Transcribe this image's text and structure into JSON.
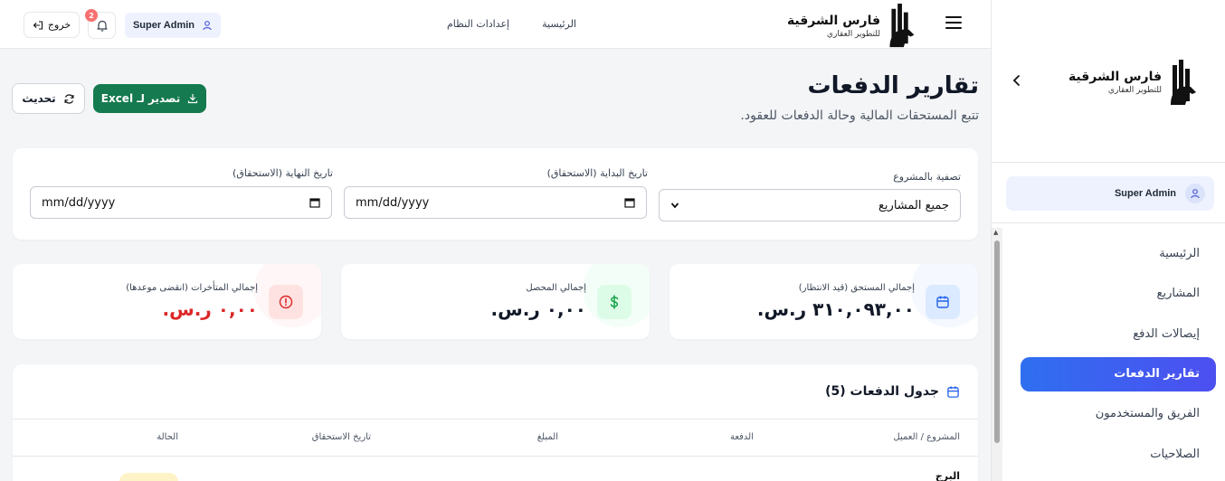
{
  "brand": {
    "name": "فارس الشرقية",
    "tagline": "للتطوير العقاري"
  },
  "topbar": {
    "nav": [
      {
        "label": "الرئيسية"
      },
      {
        "label": "إعدادات النظام"
      }
    ],
    "user_name": "Super Admin",
    "notifications_count": "2",
    "logout_label": "خروج"
  },
  "sidebar": {
    "user_name": "Super Admin",
    "items": [
      {
        "label": "الرئيسية"
      },
      {
        "label": "المشاريع"
      },
      {
        "label": "إيصالات الدفع"
      },
      {
        "label": "تقارير الدفعات",
        "active": true
      },
      {
        "label": "الفريق والمستخدمون"
      },
      {
        "label": "الصلاحيات"
      }
    ]
  },
  "page": {
    "title": "تقارير الدفعات",
    "subtitle": "تتبع المستحقات المالية وحالة الدفعات للعقود.",
    "export_label": "تصدير لـ Excel",
    "refresh_label": "تحديث"
  },
  "filters": {
    "project_label": "تصفية بالمشروع",
    "project_value": "جميع المشاريع",
    "start_label": "تاريخ البداية (الاستحقاق)",
    "start_placeholder": "mm/dd/yyyy",
    "end_label": "تاريخ النهاية (الاستحقاق)",
    "end_placeholder": "mm/dd/yyyy"
  },
  "stats": [
    {
      "label": "إجمالي المستحق (قيد الانتظار)",
      "value": "٣١٠,٠٩٣,٠٠ ر.س.",
      "color": "#111827",
      "icon": "calendar-icon",
      "accent": "#dbeafe",
      "icon_color": "#2563eb"
    },
    {
      "label": "إجمالي المحصل",
      "value": "٠,٠٠ ر.س.",
      "color": "#111827",
      "icon": "dollar-icon",
      "accent": "#dcfce7",
      "icon_color": "#16a34a"
    },
    {
      "label": "إجمالي المتأخرات (انقضى موعدها)",
      "value": "٠,٠٠ ر.س.",
      "color": "#dc2626",
      "icon": "alert-circle-icon",
      "accent": "#fee2e2",
      "icon_color": "#dc2626"
    }
  ],
  "table": {
    "title": "جدول الدفعات (5)",
    "columns": [
      {
        "label": "المشروع / العميل"
      },
      {
        "label": "الدفعة"
      },
      {
        "label": "المبلغ"
      },
      {
        "label": "تاريخ الاستحقاق"
      },
      {
        "label": "الحالة"
      }
    ],
    "first_row": {
      "project": "البرج"
    }
  }
}
